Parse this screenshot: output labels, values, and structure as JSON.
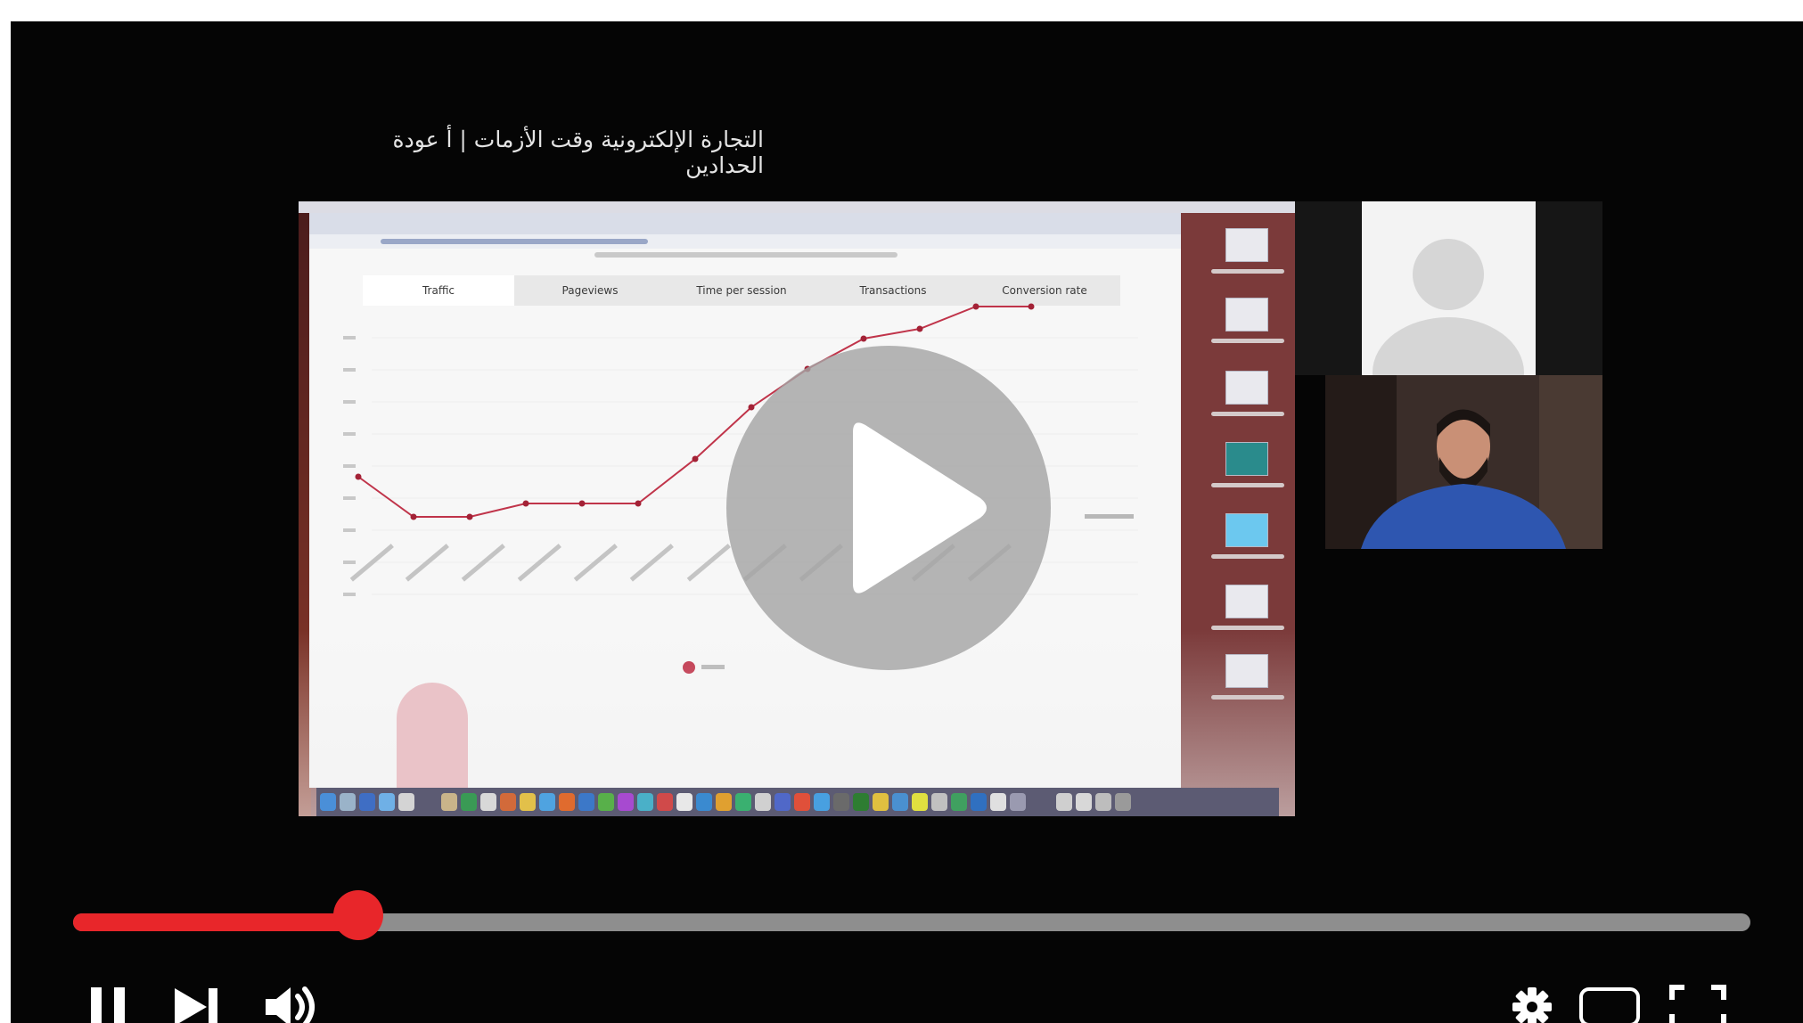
{
  "video": {
    "title": "التجارة الإلكترونية وقت الأزمات | أ عودة الحدادين"
  },
  "shared_screen": {
    "chart_tabs": [
      "Traffic",
      "Pageviews",
      "Time per session",
      "Transactions",
      "Conversion rate"
    ],
    "active_tab_index": 0,
    "line_color": "#c0344a"
  },
  "player": {
    "progress_fraction": 0.17,
    "played_color": "#e8262a",
    "track_color": "#8e8e8e",
    "state": "paused-overlay",
    "controls": {
      "pause_icon": "pause-icon",
      "next_icon": "next-icon",
      "volume_icon": "volume-icon",
      "settings_icon": "settings-gear-icon",
      "theater_icon": "theater-mode-icon",
      "fullscreen_icon": "fullscreen-icon"
    }
  }
}
